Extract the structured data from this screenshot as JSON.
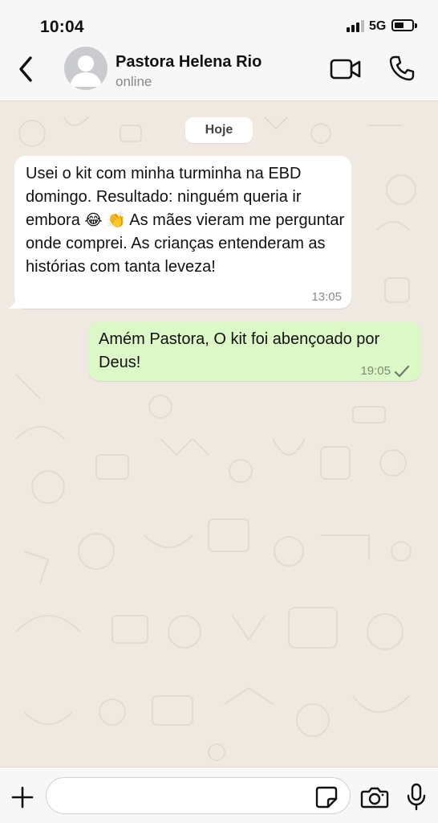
{
  "status_bar": {
    "time": "10:04",
    "network": "5G"
  },
  "header": {
    "contact_name": "Pastora Helena Rio",
    "contact_status": "online",
    "icons": [
      "back-chevron-icon",
      "avatar-placeholder",
      "video-call-icon",
      "phone-call-icon"
    ]
  },
  "chat": {
    "date_label": "Hoje",
    "messages": [
      {
        "direction": "incoming",
        "text_parts": [
          "Usei o kit com minha turminha na EBD domingo. Resultado: ninguém queria ir embora ",
          "😂",
          " ",
          "👏",
          " As mães vieram me perguntar onde comprei. As crianças entenderam as histórias com tanta leveza!"
        ],
        "time": "13:05"
      },
      {
        "direction": "outgoing",
        "text": "Amém Pastora, O kit foi abençoado por Deus!",
        "time": "19:05",
        "status": "sent"
      }
    ]
  },
  "composer": {
    "placeholder": "",
    "icons": [
      "plus-icon",
      "sticker-icon",
      "camera-icon",
      "microphone-icon"
    ]
  },
  "colors": {
    "chat_background": "#efe9e1",
    "incoming_bubble": "#ffffff",
    "outgoing_bubble": "#dcf8c6",
    "bar_background": "#f7f7f7"
  }
}
